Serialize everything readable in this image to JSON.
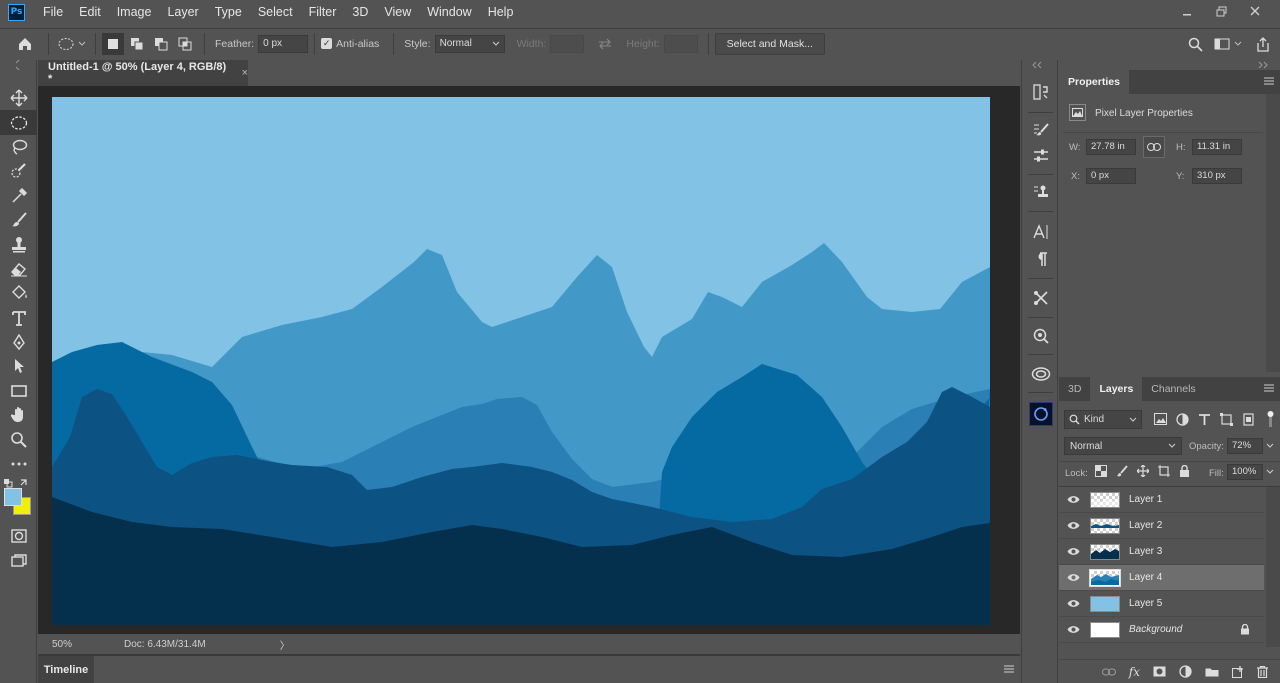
{
  "app": {
    "logo": "Ps",
    "menu": [
      "File",
      "Edit",
      "Image",
      "Layer",
      "Type",
      "Select",
      "Filter",
      "3D",
      "View",
      "Window",
      "Help"
    ]
  },
  "options": {
    "feather_label": "Feather:",
    "feather_value": "0 px",
    "antialias_label": "Anti-alias",
    "antialias_checked": true,
    "style_label": "Style:",
    "style_value": "Normal",
    "width_label": "Width:",
    "height_label": "Height:",
    "mask_button": "Select and Mask..."
  },
  "document": {
    "tab_title": "Untitled-1 @ 50% (Layer 4, RGB/8) *",
    "close": "×",
    "zoom": "50%",
    "doc_info": "Doc: 6.43M/31.4M",
    "status_arrow": "〉",
    "timeline_label": "Timeline"
  },
  "canvas_colors": {
    "sky": "#82c2e5",
    "far": "#4299c8",
    "mid": "#2a7fb4",
    "near": "#066aa2",
    "dark": "#0c5282",
    "base": "#04304d"
  },
  "properties": {
    "tab": "Properties",
    "section": "Pixel Layer Properties",
    "w_label": "W:",
    "w_value": "27.78 in",
    "h_label": "H:",
    "h_value": "11.31 in",
    "x_label": "X:",
    "x_value": "0 px",
    "y_label": "Y:",
    "y_value": "310 px"
  },
  "layers_panel": {
    "tabs": [
      "3D",
      "Layers",
      "Channels"
    ],
    "active_tab": "Layers",
    "filter_kind": "Kind",
    "blend_mode": "Normal",
    "opacity_label": "Opacity:",
    "opacity_value": "72%",
    "lock_label": "Lock:",
    "fill_label": "Fill:",
    "fill_value": "100%",
    "layers": [
      {
        "name": "Layer 1",
        "thumb": "checker-w",
        "selected": false
      },
      {
        "name": "Layer 2",
        "thumb": "checker-b",
        "selected": false
      },
      {
        "name": "Layer 3",
        "thumb": "checker-m",
        "selected": false
      },
      {
        "name": "Layer 4",
        "thumb": "mountain",
        "selected": true
      },
      {
        "name": "Layer 5",
        "thumb": "sky",
        "selected": false
      },
      {
        "name": "Background",
        "thumb": "white",
        "selected": false,
        "locked": true
      }
    ]
  },
  "icons": {
    "home": "home-icon",
    "marquee": "elliptical-marquee-icon",
    "search": "search-icon",
    "share": "share-icon",
    "eye": "eye-icon",
    "lock": "lock-icon"
  }
}
